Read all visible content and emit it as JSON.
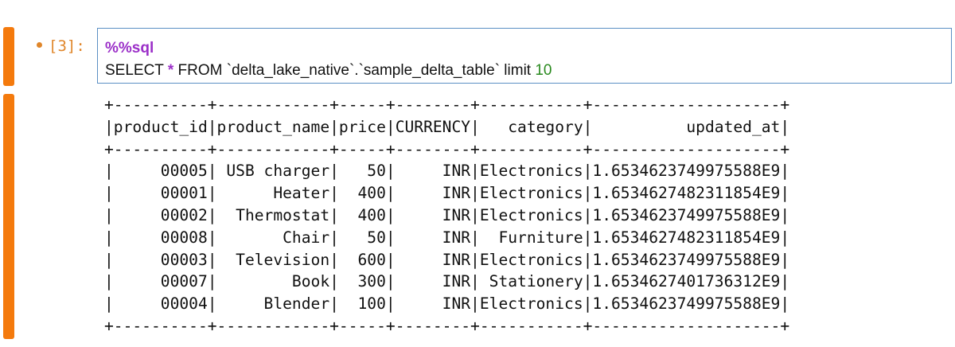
{
  "cell": {
    "prompt": "[3]:",
    "magic": "%%sql",
    "sql_before_star": "SELECT ",
    "sql_star": "*",
    "sql_after_star": " FROM `delta_lake_native`.`sample_delta_table` limit ",
    "sql_limit": "10"
  },
  "output": {
    "border": "+----------+------------+-----+--------+-----------+--------------------+",
    "header": "|product_id|product_name|price|CURRENCY|   category|          updated_at|",
    "rows": [
      "|     00005| USB charger|   50|     INR|Electronics|1.6534623749975588E9|",
      "|     00001|      Heater|  400|     INR|Electronics|1.6534627482311854E9|",
      "|     00002|  Thermostat|  400|     INR|Electronics|1.6534623749975588E9|",
      "|     00008|       Chair|   50|     INR|  Furniture|1.6534627482311854E9|",
      "|     00003|  Television|  600|     INR|Electronics|1.6534623749975588E9|",
      "|     00007|        Book|  300|     INR| Stationery|1.6534627401736312E9|",
      "|     00004|     Blender|  100|     INR|Electronics|1.6534623749975588E9|"
    ]
  },
  "colors": {
    "cell_bar": "#f47a0d",
    "prompt": "#e0862a",
    "editor_border": "#5b8fc4",
    "magic": "#9b2fc8",
    "number": "#2a8a1f"
  }
}
